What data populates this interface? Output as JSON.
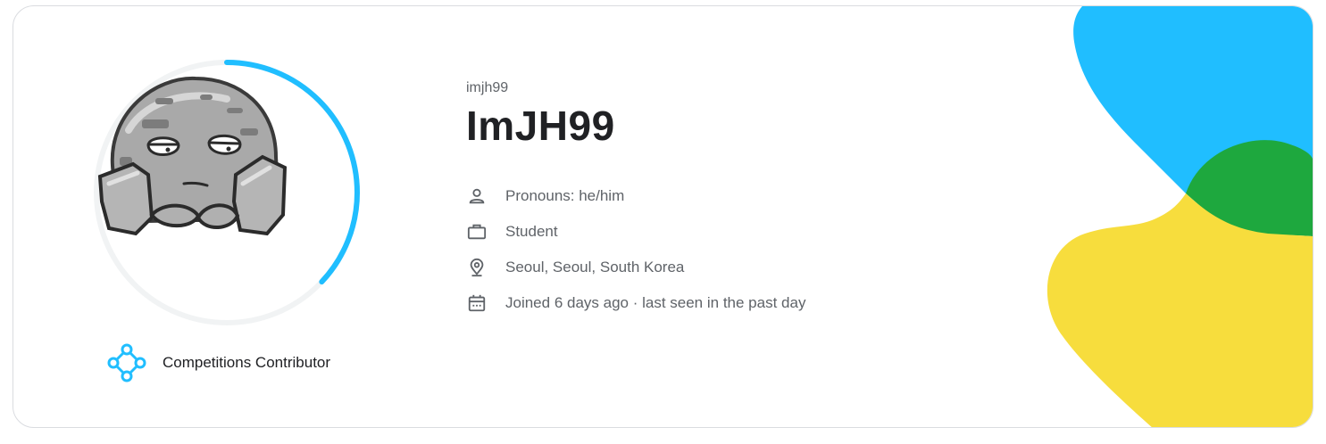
{
  "profile": {
    "username": "imjh99",
    "display_name": "ImJH99",
    "progress_fraction": 0.37,
    "tier": {
      "label": "Competitions Contributor",
      "icon": "tier-nodes-icon"
    },
    "details": [
      {
        "icon": "person-icon",
        "text": "Pronouns: he/him"
      },
      {
        "icon": "briefcase-icon",
        "text": "Student"
      },
      {
        "icon": "location-pin-icon",
        "text": "Seoul, Seoul, South Korea"
      },
      {
        "icon": "calendar-icon",
        "text": "Joined 6 days ago · last seen in the past day"
      }
    ]
  },
  "colors": {
    "progress": "#20beff",
    "track": "#f1f3f4",
    "blue": "#20beff",
    "green": "#1ea83e",
    "yellow": "#f7dd3d",
    "tier": "#20beff"
  }
}
